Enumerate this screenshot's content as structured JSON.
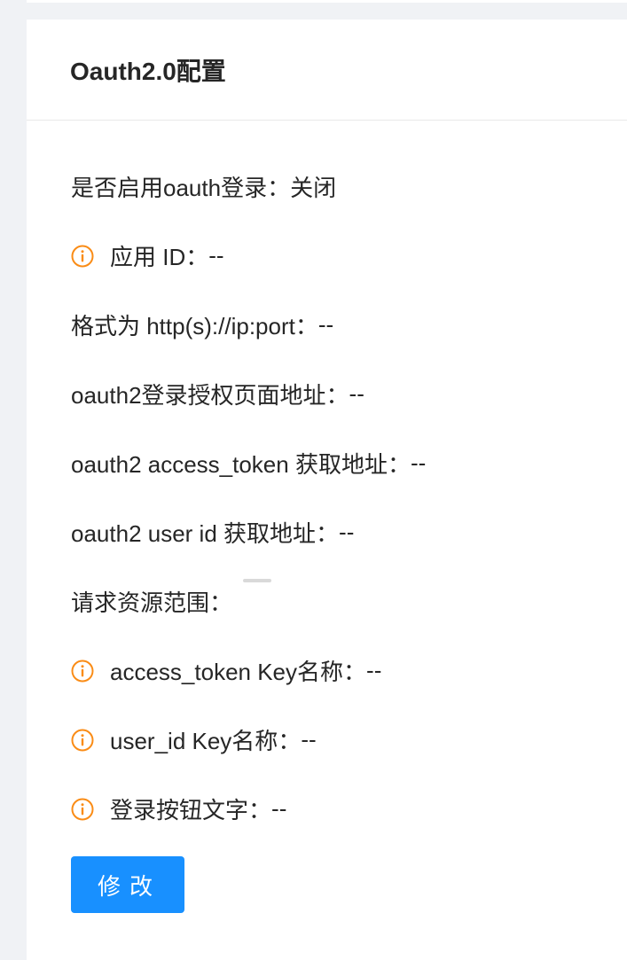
{
  "card": {
    "title": "Oauth2.0配置"
  },
  "colors": {
    "accent": "#1890ff",
    "info_icon": "#fa8c16",
    "text": "#262626"
  },
  "fields": {
    "enabled": {
      "label": "是否启用oauth登录",
      "value": "关闭"
    },
    "app_id": {
      "label": "应用 ID",
      "value": "--",
      "icon": "info-circle-icon"
    },
    "format": {
      "label": "格式为 http(s)://ip:port",
      "value": "--"
    },
    "auth_url": {
      "label": "oauth2登录授权页面地址",
      "value": "--"
    },
    "token_url": {
      "label": "oauth2 access_token 获取地址",
      "value": "--"
    },
    "userid_url": {
      "label": "oauth2 user id 获取地址",
      "value": "--"
    },
    "scope": {
      "label": "请求资源范围",
      "value": ""
    },
    "token_key": {
      "label": "access_token Key名称",
      "value": "--",
      "icon": "info-circle-icon"
    },
    "userid_key": {
      "label": "user_id Key名称",
      "value": "--",
      "icon": "info-circle-icon"
    },
    "login_text": {
      "label": "登录按钮文字",
      "value": "--",
      "icon": "info-circle-icon"
    }
  },
  "colon": "：",
  "actions": {
    "modify_label": "修改"
  }
}
